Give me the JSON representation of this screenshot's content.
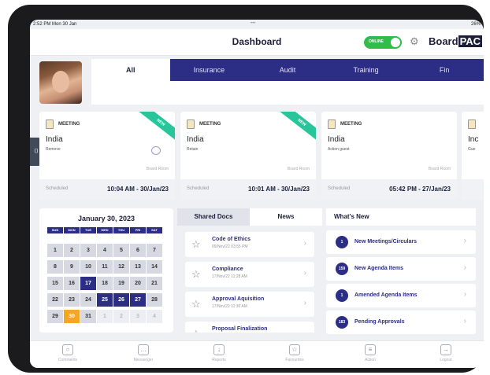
{
  "status": {
    "time": "2:52 PM  Mon 30 Jan",
    "dots": "•••",
    "battery": "26%"
  },
  "header": {
    "title": "Dashboard",
    "online_label": "ONLINE",
    "logo_a": "Board",
    "logo_b": "PAC"
  },
  "tabs": [
    "All",
    "Insurance",
    "Audit",
    "Training",
    "Fin"
  ],
  "cards": [
    {
      "type": "MEETING",
      "name": "India",
      "sub": "Remove",
      "location": "Board Room",
      "status": "Scheduled",
      "datetime": "10:04 AM - 30/Jan/23",
      "badge": "NEW"
    },
    {
      "type": "MEETING",
      "name": "India",
      "sub": "Retain",
      "location": "Board Room",
      "status": "Scheduled",
      "datetime": "10:01 AM - 30/Jan/23",
      "badge": "NEW"
    },
    {
      "type": "MEETING",
      "name": "India",
      "sub": "Action guest",
      "location": "Board Room",
      "status": "Scheduled",
      "datetime": "05:42 PM - 27/Jan/23"
    },
    {
      "name": "Inc",
      "sub": "Gue"
    }
  ],
  "calendar": {
    "title": "January 30, 2023",
    "days": [
      "SUN",
      "MON",
      "TUE",
      "WED",
      "THU",
      "FRI",
      "SAT"
    ],
    "cells": [
      "1",
      "2",
      "3",
      "4",
      "5",
      "6",
      "7",
      "8",
      "9",
      "10",
      "11",
      "12",
      "13",
      "14",
      "15",
      "16",
      "17",
      "18",
      "19",
      "20",
      "21",
      "22",
      "23",
      "24",
      "25",
      "26",
      "27",
      "28",
      "29",
      "30",
      "31",
      "1",
      "2",
      "3",
      "4"
    ]
  },
  "docs": {
    "tab_shared": "Shared Docs",
    "tab_news": "News",
    "items": [
      {
        "title": "Code of Ethics",
        "date": "09/Nov/22 03:55 PM"
      },
      {
        "title": "Compliance",
        "date": "17/Nov/22 11:28 AM"
      },
      {
        "title": "Approval Aquisition",
        "date": "17/Nov/22 11:30 AM"
      },
      {
        "title": "Proposal Finalization",
        "date": ""
      }
    ]
  },
  "whatsnew": {
    "title": "What's New",
    "items": [
      {
        "count": "1",
        "label": "New Meetings/Circulars"
      },
      {
        "count": "159",
        "label": "New Agenda Items"
      },
      {
        "count": "1",
        "label": "Amended Agenda Items"
      },
      {
        "count": "183",
        "label": "Pending Approvals"
      }
    ]
  },
  "bottom": [
    "Comments",
    "Messenger",
    "Reports",
    "Favourites",
    "Action",
    "Logout"
  ]
}
